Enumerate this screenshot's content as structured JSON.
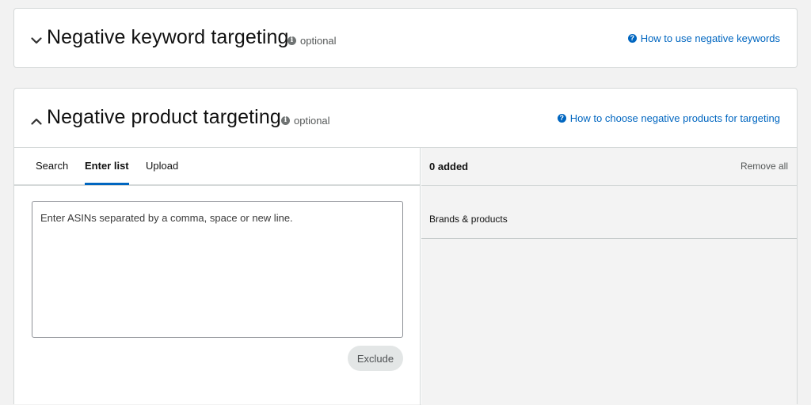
{
  "keyword_section": {
    "title": "Negative keyword targeting",
    "optional_label": "optional",
    "help_link": "How to use negative keywords",
    "expanded": false
  },
  "product_section": {
    "title": "Negative product targeting",
    "optional_label": "optional",
    "help_link": "How to choose negative products for targeting",
    "expanded": true,
    "tabs": [
      {
        "label": "Search",
        "active": false
      },
      {
        "label": "Enter list",
        "active": true
      },
      {
        "label": "Upload",
        "active": false
      }
    ],
    "asin_input": {
      "placeholder": "Enter ASINs separated by a comma, space or new line.",
      "value": ""
    },
    "exclude_button": "Exclude",
    "added_count": "0 added",
    "remove_all": "Remove all",
    "column_header": "Brands & products"
  },
  "colors": {
    "link": "#0066c0",
    "border": "#d5d9d9",
    "right_pane_bg": "#f3f3f3",
    "button_bg": "#e3e6e6"
  }
}
